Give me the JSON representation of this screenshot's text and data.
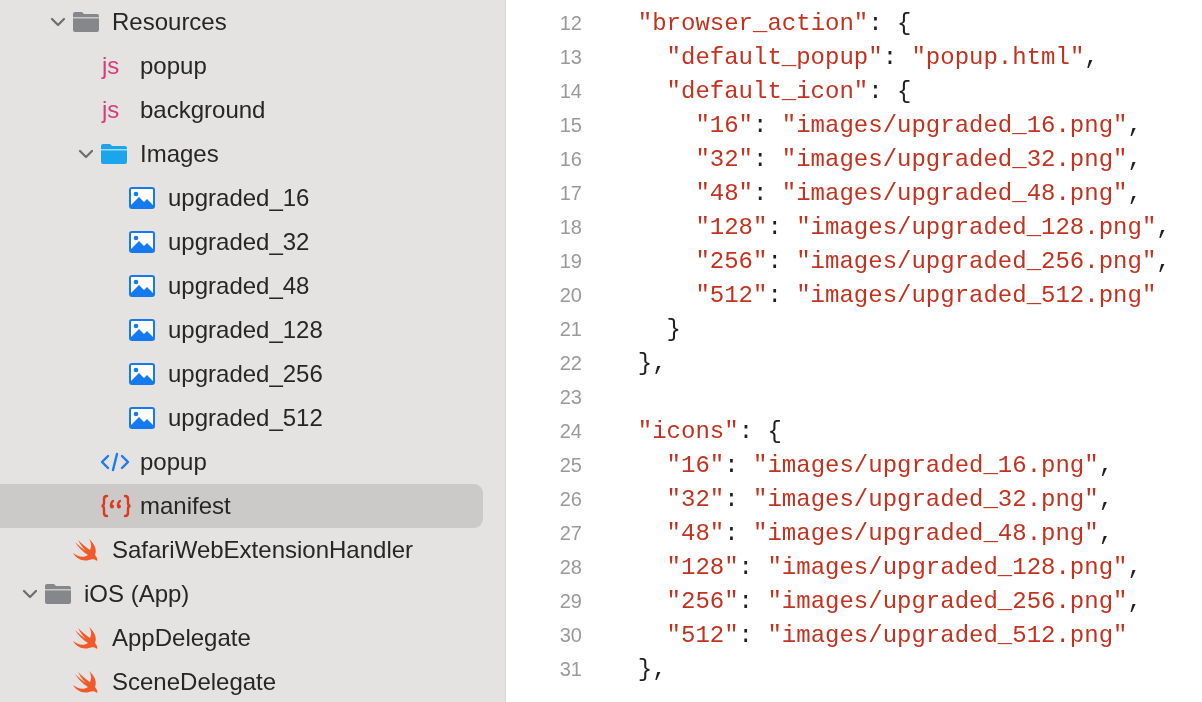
{
  "navigator": {
    "continued": [
      {
        "label": "Resources",
        "kind": "group",
        "expanded": true,
        "selected": false,
        "children": [
          {
            "label": "popup",
            "kind": "js",
            "icon_label": "js",
            "selected": false
          },
          {
            "label": "background",
            "kind": "js",
            "icon_label": "js",
            "selected": false
          },
          {
            "label": "Images",
            "kind": "folder",
            "expanded": true,
            "selected": false,
            "children": [
              {
                "label": "upgraded_16",
                "kind": "image",
                "selected": false
              },
              {
                "label": "upgraded_32",
                "kind": "image",
                "selected": false
              },
              {
                "label": "upgraded_48",
                "kind": "image",
                "selected": false
              },
              {
                "label": "upgraded_128",
                "kind": "image",
                "selected": false
              },
              {
                "label": "upgraded_256",
                "kind": "image",
                "selected": false
              },
              {
                "label": "upgraded_512",
                "kind": "image",
                "selected": false
              }
            ]
          },
          {
            "label": "popup",
            "kind": "html",
            "selected": false
          },
          {
            "label": "manifest",
            "kind": "json",
            "selected": true
          }
        ]
      },
      {
        "label": "SafariWebExtensionHandler",
        "kind": "swift",
        "selected": false
      }
    ],
    "nodes": [
      {
        "label": "iOS (App)",
        "kind": "group",
        "expanded": true,
        "selected": false,
        "children": [
          {
            "label": "AppDelegate",
            "kind": "swift",
            "selected": false
          },
          {
            "label": "SceneDelegate",
            "kind": "swift",
            "selected": false
          }
        ]
      }
    ]
  },
  "editor": {
    "lines": [
      {
        "number": "12",
        "tokens": [
          {
            "kind": "string",
            "text": "\"browser_action\""
          },
          {
            "kind": "punct",
            "text": ": {"
          }
        ],
        "children": [
          {
            "number": "13",
            "tokens": [
              {
                "kind": "string",
                "text": "\"default_popup\""
              },
              {
                "kind": "punct",
                "text": ": "
              },
              {
                "kind": "string",
                "text": "\"popup.html\""
              },
              {
                "kind": "punct",
                "text": ","
              }
            ]
          },
          {
            "number": "14",
            "tokens": [
              {
                "kind": "string",
                "text": "\"default_icon\""
              },
              {
                "kind": "punct",
                "text": ": {"
              }
            ],
            "children": [
              {
                "number": "15",
                "tokens": [
                  {
                    "kind": "string",
                    "text": "\"16\""
                  },
                  {
                    "kind": "punct",
                    "text": ": "
                  },
                  {
                    "kind": "string",
                    "text": "\"images/upgraded_16.png\""
                  },
                  {
                    "kind": "punct",
                    "text": ","
                  }
                ]
              },
              {
                "number": "16",
                "tokens": [
                  {
                    "kind": "string",
                    "text": "\"32\""
                  },
                  {
                    "kind": "punct",
                    "text": ": "
                  },
                  {
                    "kind": "string",
                    "text": "\"images/upgraded_32.png\""
                  },
                  {
                    "kind": "punct",
                    "text": ","
                  }
                ]
              },
              {
                "number": "17",
                "tokens": [
                  {
                    "kind": "string",
                    "text": "\"48\""
                  },
                  {
                    "kind": "punct",
                    "text": ": "
                  },
                  {
                    "kind": "string",
                    "text": "\"images/upgraded_48.png\""
                  },
                  {
                    "kind": "punct",
                    "text": ","
                  }
                ]
              },
              {
                "number": "18",
                "tokens": [
                  {
                    "kind": "string",
                    "text": "\"128\""
                  },
                  {
                    "kind": "punct",
                    "text": ": "
                  },
                  {
                    "kind": "string",
                    "text": "\"images/upgraded_128.png\""
                  },
                  {
                    "kind": "punct",
                    "text": ","
                  }
                ]
              },
              {
                "number": "19",
                "tokens": [
                  {
                    "kind": "string",
                    "text": "\"256\""
                  },
                  {
                    "kind": "punct",
                    "text": ": "
                  },
                  {
                    "kind": "string",
                    "text": "\"images/upgraded_256.png\""
                  },
                  {
                    "kind": "punct",
                    "text": ","
                  }
                ]
              },
              {
                "number": "20",
                "tokens": [
                  {
                    "kind": "string",
                    "text": "\"512\""
                  },
                  {
                    "kind": "punct",
                    "text": ": "
                  },
                  {
                    "kind": "string",
                    "text": "\"images/upgraded_512.png\""
                  }
                ]
              }
            ]
          },
          {
            "number": "21",
            "tokens": [
              {
                "kind": "punct",
                "text": "}"
              }
            ]
          }
        ]
      },
      {
        "number": "22",
        "tokens": [
          {
            "kind": "punct",
            "text": "},"
          }
        ]
      },
      {
        "number": "23"
      },
      {
        "number": "24",
        "tokens": [
          {
            "kind": "string",
            "text": "\"icons\""
          },
          {
            "kind": "punct",
            "text": ": {"
          }
        ],
        "children": [
          {
            "number": "25",
            "tokens": [
              {
                "kind": "string",
                "text": "\"16\""
              },
              {
                "kind": "punct",
                "text": ": "
              },
              {
                "kind": "string",
                "text": "\"images/upgraded_16.png\""
              },
              {
                "kind": "punct",
                "text": ","
              }
            ]
          },
          {
            "number": "26",
            "tokens": [
              {
                "kind": "string",
                "text": "\"32\""
              },
              {
                "kind": "punct",
                "text": ": "
              },
              {
                "kind": "string",
                "text": "\"images/upgraded_32.png\""
              },
              {
                "kind": "punct",
                "text": ","
              }
            ]
          },
          {
            "number": "27",
            "tokens": [
              {
                "kind": "string",
                "text": "\"48\""
              },
              {
                "kind": "punct",
                "text": ": "
              },
              {
                "kind": "string",
                "text": "\"images/upgraded_48.png\""
              },
              {
                "kind": "punct",
                "text": ","
              }
            ]
          },
          {
            "number": "28",
            "tokens": [
              {
                "kind": "string",
                "text": "\"128\""
              },
              {
                "kind": "punct",
                "text": ": "
              },
              {
                "kind": "string",
                "text": "\"images/upgraded_128.png\""
              },
              {
                "kind": "punct",
                "text": ","
              }
            ]
          },
          {
            "number": "29",
            "tokens": [
              {
                "kind": "string",
                "text": "\"256\""
              },
              {
                "kind": "punct",
                "text": ": "
              },
              {
                "kind": "string",
                "text": "\"images/upgraded_256.png\""
              },
              {
                "kind": "punct",
                "text": ","
              }
            ]
          },
          {
            "number": "30",
            "tokens": [
              {
                "kind": "string",
                "text": "\"512\""
              },
              {
                "kind": "punct",
                "text": ": "
              },
              {
                "kind": "string",
                "text": "\"images/upgraded_512.png\""
              }
            ]
          }
        ]
      },
      {
        "number": "31",
        "tokens": [
          {
            "kind": "punct",
            "text": "},"
          }
        ]
      }
    ]
  }
}
